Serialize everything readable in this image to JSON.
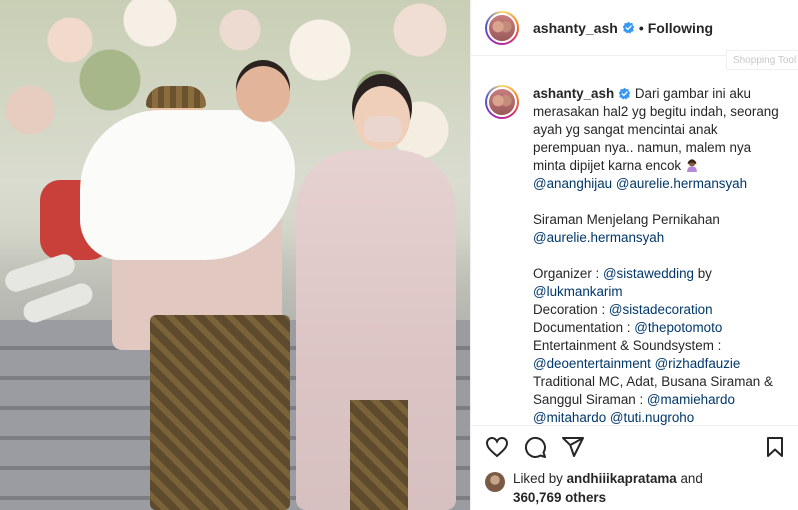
{
  "post": {
    "username": "ashanty_ash",
    "separator": "•",
    "follow_status": "Following",
    "tooltip_text": "Shopping Tool"
  },
  "caption": {
    "username": "ashanty_ash",
    "line1": " Dari gambar ini aku merasakan hal2 yg begitu indah, seorang ayah yg sangat mencintai anak perempuan nya.. namun, malem nya minta dipijet karna encok",
    "mention_anang": "@ananghijau",
    "mention_aurelie1": "@aurelie.hermansyah",
    "siraman_title": "Siraman Menjelang Pernikahan",
    "mention_aurelie2": "@aurelie.hermansyah",
    "organizer_label": "Organizer : ",
    "mention_sistawedding": "@sistawedding",
    "by": " by",
    "mention_lukman": "@lukmankarim",
    "decoration_label": "Decoration : ",
    "mention_sistadecoration": "@sistadecoration",
    "documentation_label": "Documentation : ",
    "mention_thepotomoto": "@thepotomoto",
    "entertainment_label": "Entertainment & Soundsystem :",
    "mention_deo": "@deoentertainment",
    "mention_rizhad": "@rizhadfauzie",
    "traditional_label": "Traditional MC, Adat, Busana Siraman & Sanggul Siraman : ",
    "mention_mamie": "@mamiehardo",
    "mention_mita": "@mitahardo",
    "mention_tuti": "@tuti.nugroho"
  },
  "likes": {
    "prefix": "Liked by ",
    "user": "andhiiikapratama",
    "and": " and",
    "count": "360,769 others"
  },
  "icons": {
    "verified": "verified-badge-icon",
    "emoji": "woman-gesturing-emoji",
    "like": "heart-icon",
    "comment": "comment-icon",
    "share": "share-icon",
    "save": "bookmark-icon"
  },
  "colors": {
    "text": "#262626",
    "mention": "#00376b",
    "verified": "#3897f0",
    "border": "#efefef"
  }
}
